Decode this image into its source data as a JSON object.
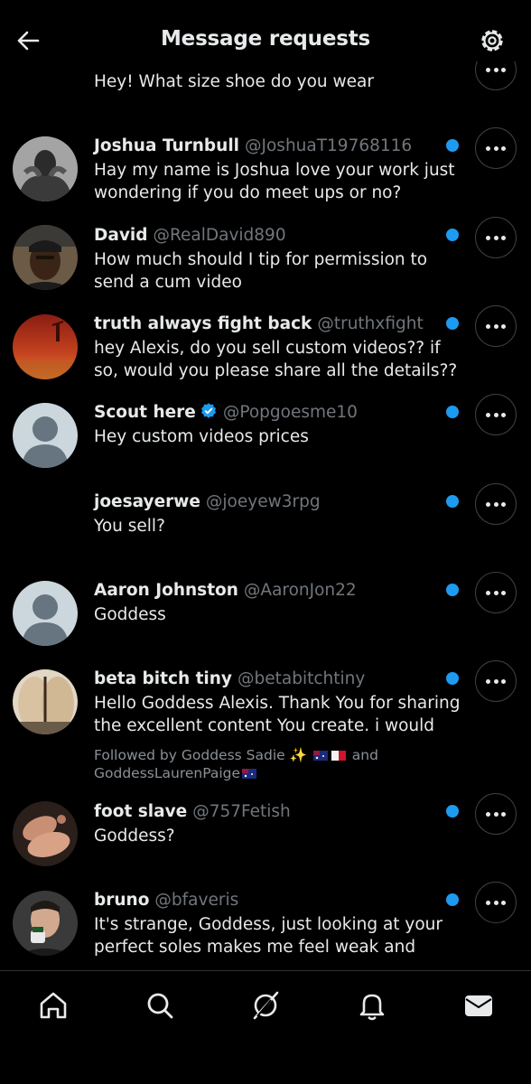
{
  "header": {
    "title": "Message requests",
    "back_icon": "arrow-left-icon",
    "settings_icon": "gear-icon"
  },
  "partial_message": {
    "body": "Hey! What size shoe do you wear"
  },
  "requests": [
    {
      "name": "Joshua Turnbull",
      "handle": "@JoshuaT19768116",
      "body": "Hay my name is Joshua love your work just wondering if you do meet ups or no?"
    },
    {
      "name": "David",
      "handle": "@RealDavid890",
      "body": "How much should I tip for permission to send a cum video"
    },
    {
      "name": "truth always fight back",
      "handle": "@truthxfight",
      "body": "hey Alexis, do you sell custom videos?? if so, would you please share all the details??"
    },
    {
      "name": "Scout here",
      "handle": "@Popgoesme10",
      "body": "Hey custom videos prices",
      "verified": true
    },
    {
      "name": "joesayerwe",
      "handle": "@joeyew3rpg",
      "body": "You sell?"
    },
    {
      "name": "Aaron Johnston",
      "handle": "@AaronJon22",
      "body": "Goddess"
    },
    {
      "name": "beta bitch tiny",
      "handle": "@betabitchtiny",
      "body": "Hello Goddess Alexis. Thank You for sharing the excellent content You create. i would",
      "followed_by_prefix": "Followed by Goddess Sadie ✨",
      "followed_by_and": "and",
      "followed_by_second": "GoddessLaurenPaige"
    },
    {
      "name": "foot slave",
      "handle": "@757Fetish",
      "body": "Goddess?"
    },
    {
      "name": "bruno",
      "handle": "@bfaveris",
      "body": "It's strange, Goddess, just looking at your perfect soles makes me feel weak and"
    }
  ],
  "nav": {
    "items": [
      "home-icon",
      "search-icon",
      "grok-icon",
      "notifications-icon",
      "messages-icon"
    ]
  },
  "colors": {
    "background": "#000000",
    "unread_dot": "#1d9bf0",
    "secondary_text": "#71767b"
  }
}
